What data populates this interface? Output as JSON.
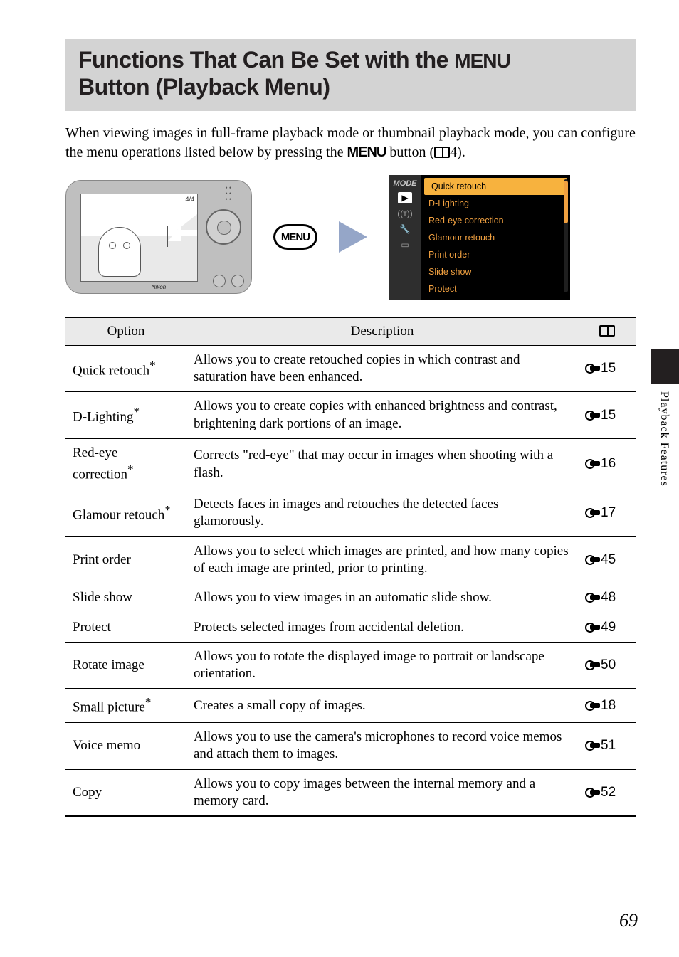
{
  "side_tab": {
    "label": "Playback Features"
  },
  "title_line1": "Functions That Can Be Set with the ",
  "title_menu_glyph": "MENU",
  "title_line2": "Button (Playback Menu)",
  "intro_part1": "When viewing images in full-frame playback mode or thumbnail playback mode, you can configure the menu operations listed below by pressing the ",
  "intro_menu": "MENU",
  "intro_part2": " button (",
  "intro_ref": "4",
  "intro_part3": ").",
  "cam_counter": "4/4",
  "cam_logo": "Nikon",
  "menu_button_label": "MENU",
  "menu_preview": {
    "mode_label": "MODE",
    "play_icon": "▶",
    "antenna_icon": "((ᴛ))",
    "wrench_icon": "🔧",
    "card_icon": "▭",
    "items": [
      "Quick retouch",
      "D-Lighting",
      "Red-eye correction",
      "Glamour retouch",
      "Print order",
      "Slide show",
      "Protect"
    ],
    "selected_index": 0
  },
  "table": {
    "headers": {
      "option": "Option",
      "description": "Description"
    },
    "rows": [
      {
        "option": "Quick retouch",
        "star": true,
        "desc": "Allows you to create retouched copies in which contrast and saturation have been enhanced.",
        "ref": "15"
      },
      {
        "option": "D-Lighting",
        "star": true,
        "desc": "Allows you to create copies with enhanced brightness and contrast, brightening dark portions of an image.",
        "ref": "15"
      },
      {
        "option": "Red-eye correction",
        "star": true,
        "desc": "Corrects \"red-eye\" that may occur in images when shooting with a flash.",
        "ref": "16"
      },
      {
        "option": "Glamour retouch",
        "star": true,
        "desc": "Detects faces in images and retouches the detected faces glamorously.",
        "ref": "17"
      },
      {
        "option": "Print order",
        "star": false,
        "desc": "Allows you to select which images are printed, and how many copies of each image are printed, prior to printing.",
        "ref": "45"
      },
      {
        "option": "Slide show",
        "star": false,
        "desc": "Allows you to view images in an automatic slide show.",
        "ref": "48"
      },
      {
        "option": "Protect",
        "star": false,
        "desc": "Protects selected images from accidental deletion.",
        "ref": "49"
      },
      {
        "option": "Rotate image",
        "star": false,
        "desc": "Allows you to rotate the displayed image to portrait or landscape orientation.",
        "ref": "50"
      },
      {
        "option": "Small picture",
        "star": true,
        "desc": "Creates a small copy of images.",
        "ref": "18"
      },
      {
        "option": "Voice memo",
        "star": false,
        "desc": "Allows you to use the camera's microphones to record voice memos and attach them to images.",
        "ref": "51"
      },
      {
        "option": "Copy",
        "star": false,
        "desc": "Allows you to copy images between the internal memory and a memory card.",
        "ref": "52"
      }
    ]
  },
  "page_number": "69"
}
